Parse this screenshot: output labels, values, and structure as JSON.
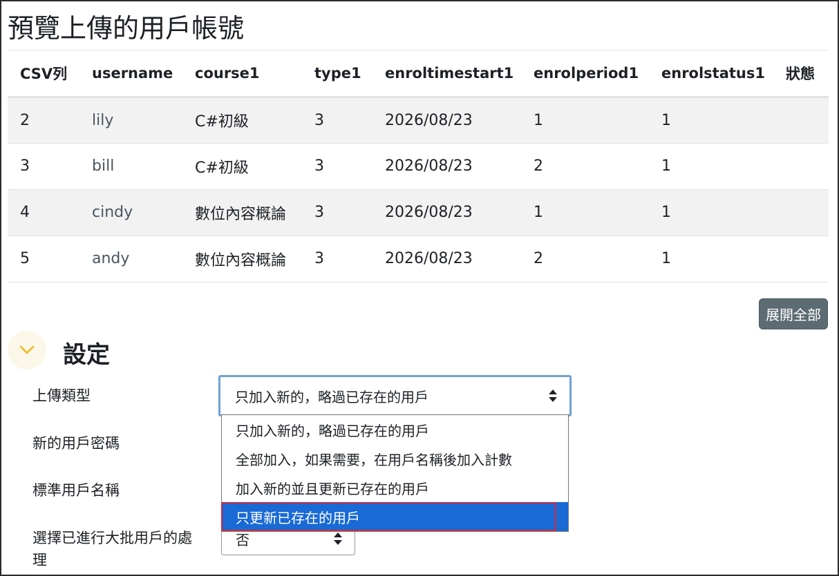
{
  "page": {
    "title": "預覽上傳的用戶帳號"
  },
  "table": {
    "headers": [
      "CSV列",
      "username",
      "course1",
      "type1",
      "enroltimestart1",
      "enrolperiod1",
      "enrolstatus1",
      "狀態"
    ],
    "rows": [
      [
        "2",
        "lily",
        "C#初級",
        "3",
        "2026/08/23",
        "1",
        "1",
        ""
      ],
      [
        "3",
        "bill",
        "C#初級",
        "3",
        "2026/08/23",
        "2",
        "1",
        ""
      ],
      [
        "4",
        "cindy",
        "數位內容概論",
        "3",
        "2026/08/23",
        "1",
        "1",
        ""
      ],
      [
        "5",
        "andy",
        "數位內容概論",
        "3",
        "2026/08/23",
        "2",
        "1",
        ""
      ]
    ]
  },
  "expand_all_label": "展開全部",
  "settings": {
    "title": "設定",
    "labels": {
      "upload_type": "上傳類型",
      "new_password": "新的用戶密碼",
      "standard_username": "標準用戶名稱",
      "bulk_line1": "選擇已進行大批用戶的處",
      "bulk_line2": "理"
    },
    "upload_type_value": "只加入新的，略過已存在的用戶",
    "bulk_value": "否"
  },
  "dropdown": {
    "options": [
      "只加入新的，略過已存在的用戶",
      "全部加入，如果需要，在用戶名稱後加入計數",
      "加入新的並且更新已存在的用戶",
      "只更新已存在的用戶"
    ],
    "highlighted_index": 3,
    "highlight_color": "#1a6ad6",
    "annotation_color": "#d3283c"
  },
  "icons": {
    "collapse": "chevron-down-icon",
    "select_arrows": "sort-arrows-icon"
  }
}
